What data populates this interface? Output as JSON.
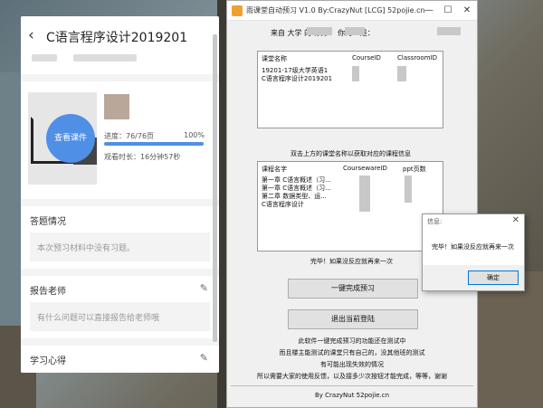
{
  "phone": {
    "title": "C语言程序设计2019201",
    "view_button": "查看课件",
    "progress_label": "进度：76/76页",
    "progress_pct": "100%",
    "progress_fraction": 1.0,
    "watch_time": "观看时长：16分钟57秒",
    "sections": [
      {
        "title": "答题情况",
        "box": "本次预习材料中没有习题。",
        "edit": false
      },
      {
        "title": "报告老师",
        "box": "有什么问题可以直接报告给老师哦",
        "edit": true
      },
      {
        "title": "学习心得",
        "box": "",
        "edit": true
      }
    ]
  },
  "app": {
    "title": "雨课堂自动预习 V1.0 By:CrazyNut [LCG] 52pojie.cn",
    "welcome": "来自          大学 的          你好！ 你的ID是：",
    "class_table": {
      "headers": [
        "课堂名称",
        "CourseID",
        "ClassroomID"
      ],
      "rows": [
        "19201-17级大学英语1",
        "C语言程序设计2019201"
      ]
    },
    "hint": "双击上方的课堂名称以获取对应的课程信息",
    "courseware_table": {
      "headers": [
        "课程名字",
        "CoursewareID",
        "ppt页数"
      ],
      "rows": [
        "第一章 C语言概述（习...",
        "第一章 C语言概述（习...",
        "第二章 数据类型、运...",
        "C语言程序设计"
      ]
    },
    "status": "完毕！如果没反应就再来一次",
    "btn_finish": "一键完成预习",
    "btn_logout": "退出当前登陆",
    "notes": [
      "此软件一键完成预习的功能还在测试中",
      "而且楼主能测试的课堂只有自己的，没其他班的测试",
      "有可能出现失效的情况",
      "所以需要大家的使用反馈，以及接多少次按钮才能完成，等等，谢谢"
    ],
    "footer": "By CrazyNut 52pojie.cn"
  },
  "msgbox": {
    "title": "信息:",
    "body": "完毕！如果没反应就再来一次",
    "ok": "确定"
  }
}
